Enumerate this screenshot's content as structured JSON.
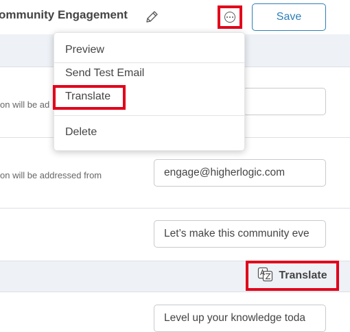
{
  "header": {
    "title": "ommunity Engagement",
    "save_label": "Save",
    "more_icon": "more-options-icon",
    "edit_icon": "pencil-icon"
  },
  "menu": {
    "items": [
      {
        "label": "Preview"
      },
      {
        "label": "Send Test Email"
      },
      {
        "label": "Translate"
      },
      {
        "label": "Delete"
      }
    ]
  },
  "form": {
    "row1_helper": "on will be ad",
    "row2_helper": "on will be addressed from",
    "from_email_value": "engage@higherlogic.com",
    "subject_value": "Let’s make this community eve",
    "preview_value": "Level up your knowledge toda"
  },
  "translate_button": {
    "label": "Translate",
    "icon": "translate-icon"
  },
  "colors": {
    "accent": "#2a7fb8",
    "highlight_border": "#e2001a",
    "band": "#eef2f7"
  }
}
